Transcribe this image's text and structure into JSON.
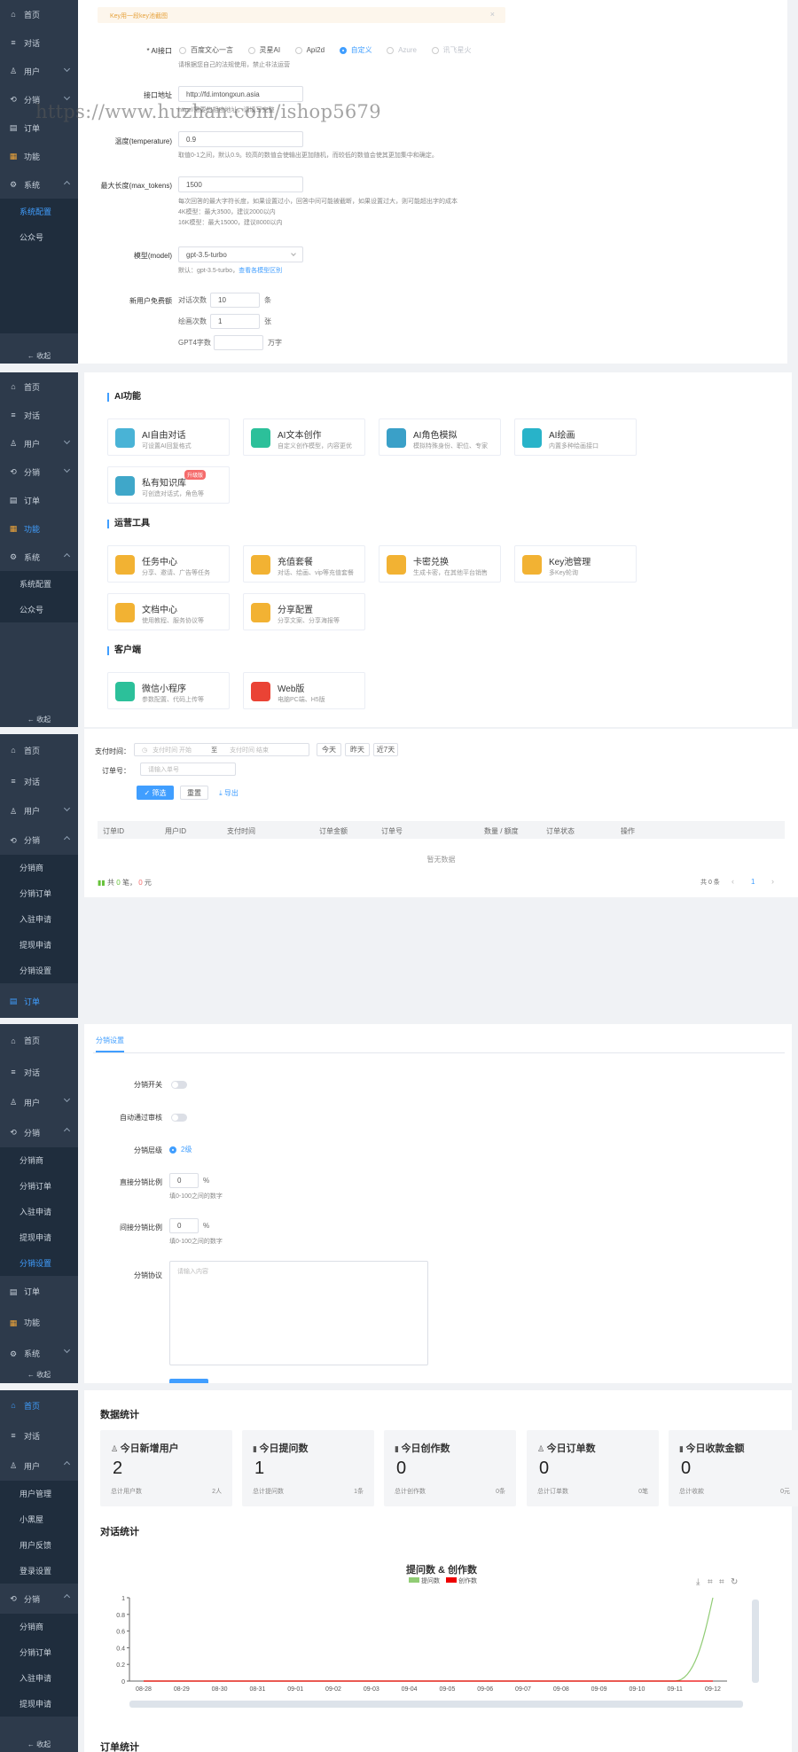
{
  "sidebar1": {
    "items": [
      {
        "label": "首页"
      },
      {
        "label": "对话"
      },
      {
        "label": "用户"
      },
      {
        "label": "分销"
      },
      {
        "label": "订单"
      },
      {
        "label": "功能"
      },
      {
        "label": "系统"
      }
    ],
    "sub": [
      {
        "label": "系统配置"
      },
      {
        "label": "公众号"
      }
    ],
    "collapse": "← 收起"
  },
  "sidebar2": {
    "items": [
      {
        "label": "首页"
      },
      {
        "label": "对话"
      },
      {
        "label": "用户"
      },
      {
        "label": "分销"
      },
      {
        "label": "订单"
      },
      {
        "label": "功能"
      },
      {
        "label": "系统"
      }
    ],
    "sub": [
      {
        "label": "系统配置"
      },
      {
        "label": "公众号"
      }
    ],
    "collapse": "← 收起"
  },
  "sidebar3": {
    "items": [
      {
        "label": "首页"
      },
      {
        "label": "对话"
      },
      {
        "label": "用户"
      },
      {
        "label": "分销"
      }
    ],
    "sub": [
      {
        "label": "分销商"
      },
      {
        "label": "分销订单"
      },
      {
        "label": "入驻申请"
      },
      {
        "label": "提现申请"
      },
      {
        "label": "分销设置"
      }
    ],
    "after": [
      {
        "label": "订单"
      }
    ]
  },
  "sidebar4": {
    "items": [
      {
        "label": "首页"
      },
      {
        "label": "对话"
      },
      {
        "label": "用户"
      },
      {
        "label": "分销"
      }
    ],
    "sub": [
      {
        "label": "分销商"
      },
      {
        "label": "分销订单"
      },
      {
        "label": "入驻申请"
      },
      {
        "label": "提现申请"
      },
      {
        "label": "分销设置"
      }
    ],
    "after": [
      {
        "label": "订单"
      },
      {
        "label": "功能"
      },
      {
        "label": "系统"
      }
    ],
    "collapse": "← 收起"
  },
  "sidebar5": {
    "items": [
      {
        "label": "首页"
      },
      {
        "label": "对话"
      },
      {
        "label": "用户"
      }
    ],
    "sub": [
      {
        "label": "用户管理"
      },
      {
        "label": "小黑屋"
      },
      {
        "label": "用户反馈"
      },
      {
        "label": "登录设置"
      }
    ],
    "after": [
      {
        "label": "分销"
      }
    ],
    "sub2": [
      {
        "label": "分销商"
      },
      {
        "label": "分销订单"
      },
      {
        "label": "入驻申请"
      },
      {
        "label": "提现申请"
      }
    ],
    "collapse": "← 收起"
  },
  "watermark": "https://www.huzhan.com/ishop5679",
  "ai_config": {
    "alert": "Key用一段key池截图",
    "alert_close": "×",
    "interface_label": "* AI接口",
    "interface_options": [
      {
        "label": "百度文心一言",
        "state": "off"
      },
      {
        "label": "灵星AI",
        "state": "off"
      },
      {
        "label": "Api2d",
        "state": "off"
      },
      {
        "label": "自定义",
        "state": "on"
      },
      {
        "label": "Azure",
        "state": "disabled"
      },
      {
        "label": "讯飞星火",
        "state": "disabled"
      }
    ],
    "interface_hint": "请根据您自己的法规使用，禁止非法运营",
    "url_label": "接口地址",
    "url_value": "http://fd.imtongxun.asia",
    "url_hint": "http://需要的相应地址，请填写完整",
    "temp_label": "温度(temperature)",
    "temp_value": "0.9",
    "temp_hint": "取值0-1之间，默认0.9。较高的数值会使输出更加随机，而较低的数值会使其更加集中和确定。",
    "max_label": "最大长度(max_tokens)",
    "max_value": "1500",
    "max_hint1": "每次回答的最大字符长度，如果设置过小，回答中间可能被截断，如果设置过大，则可能超出字的成本",
    "max_hint2": "4K模型：最大3500，建议2000以内",
    "max_hint3": "16K模型：最大15000，建议8000以内",
    "model_label": "模型(model)",
    "model_value": "gpt-3.5-turbo",
    "model_hint": "默认：gpt-3.5-turbo，",
    "model_link": "查看各模型区别",
    "free_label": "新用户免费额",
    "free_rows": [
      {
        "label": "对话次数",
        "value": "10",
        "unit": "条"
      },
      {
        "label": "绘画次数",
        "value": "1",
        "unit": "张"
      },
      {
        "label": "GPT4字数",
        "value": "",
        "unit": "万字"
      }
    ]
  },
  "features": {
    "section1": "AI功能",
    "ai_tiles": [
      {
        "title": "AI自由对话",
        "desc": "可设置AI回复格式",
        "color": "#49b3d6"
      },
      {
        "title": "AI文本创作",
        "desc": "自定义创作模型，内容更优",
        "color": "#2cc09a"
      },
      {
        "title": "AI角色模拟",
        "desc": "模拟特殊身份、职位、专家",
        "color": "#3aa0c8"
      },
      {
        "title": "AI绘画",
        "desc": "内置多种绘画接口",
        "color": "#28b3c9"
      },
      {
        "title": "私有知识库",
        "desc": "可创造对话式，角色等",
        "color": "#3fa7c9"
      }
    ],
    "new_badge": "升级版",
    "section2": "运营工具",
    "op_tiles": [
      {
        "title": "任务中心",
        "desc": "分享、邀请、广告等任务",
        "color": "#f2b233"
      },
      {
        "title": "充值套餐",
        "desc": "对话、绘画、vip等充值套餐",
        "color": "#f2b233"
      },
      {
        "title": "卡密兑换",
        "desc": "生成卡密，在其他平台销售",
        "color": "#f2b233"
      },
      {
        "title": "Key池管理",
        "desc": "多Key轮询",
        "color": "#f2b233"
      },
      {
        "title": "文档中心",
        "desc": "使用教程、服务协议等",
        "color": "#f2b233"
      },
      {
        "title": "分享配置",
        "desc": "分享文案、分享海报等",
        "color": "#f2b233"
      }
    ],
    "section3": "客户端",
    "client_tiles": [
      {
        "title": "微信小程序",
        "desc": "参数配置、代码上传等",
        "color": "#2cc09a"
      },
      {
        "title": "Web版",
        "desc": "电脑PC端、H5版",
        "color": "#ea4335"
      }
    ]
  },
  "orders": {
    "pay_time_label": "支付时间：",
    "start_placeholder": "支付时间 开始",
    "to": "至",
    "end_placeholder": "支付时间 结束",
    "quick": [
      "今天",
      "昨天",
      "近7天"
    ],
    "order_no_label": "订单号：",
    "order_no_placeholder": "请输入单号",
    "search": "✓ 筛选",
    "reset": "重置",
    "export": "⤓ 导出",
    "columns": [
      "订单ID",
      "用户ID",
      "支付时间",
      "订单金额",
      "订单号",
      "数量 / 额度",
      "订单状态",
      "操作"
    ],
    "empty": "暂无数据",
    "summary_prefix": "共",
    "summary_count": "0",
    "summary_mid": "笔，",
    "summary_amount": "0",
    "summary_suffix": "元",
    "total": "共 0 条",
    "page": "1"
  },
  "dist_settings": {
    "tab": "分销设置",
    "switch_label": "分销开关",
    "auto_label": "自动通过审核",
    "level_label": "分销层级",
    "level_value": "2级",
    "direct_label": "直接分销比例",
    "direct_value": "0",
    "direct_unit": "%",
    "direct_hint": "填0-100之间的数字",
    "indirect_label": "间接分销比例",
    "indirect_value": "0",
    "indirect_unit": "%",
    "indirect_hint": "填0-100之间的数字",
    "agreement_label": "分销协议",
    "agreement_placeholder": "请输入内容"
  },
  "dashboard": {
    "title": "数据统计",
    "stats": [
      {
        "head": "今日新增用户",
        "value": "2",
        "left": "总计用户数",
        "right": "2人",
        "icon": "user-icon"
      },
      {
        "head": "今日提问数",
        "value": "1",
        "left": "总计提问数",
        "right": "1条",
        "icon": "bar-icon"
      },
      {
        "head": "今日创作数",
        "value": "0",
        "left": "总计创作数",
        "right": "0条",
        "icon": "bar-icon"
      },
      {
        "head": "今日订单数",
        "value": "0",
        "left": "总计订单数",
        "right": "0笔",
        "icon": "user-icon"
      },
      {
        "head": "今日收款金额",
        "value": "0",
        "left": "总计收款",
        "right": "0元",
        "icon": "bar-icon"
      }
    ],
    "chat_title": "对话统计",
    "order_title": "订单统计"
  },
  "chart_data": {
    "type": "line",
    "title": "提问数 & 创作数",
    "x": [
      "08-28",
      "08-29",
      "08-30",
      "08-31",
      "09-01",
      "09-02",
      "09-03",
      "09-04",
      "09-05",
      "09-06",
      "09-07",
      "09-08",
      "09-09",
      "09-10",
      "09-11",
      "09-12"
    ],
    "yticks": [
      "0",
      "0.2",
      "0.4",
      "0.6",
      "0.8",
      "1"
    ],
    "ylim": [
      0,
      1
    ],
    "series": [
      {
        "name": "提问数",
        "color": "#91cc75",
        "values": [
          0,
          0,
          0,
          0,
          0,
          0,
          0,
          0,
          0,
          0,
          0,
          0,
          0,
          0,
          0,
          1
        ]
      },
      {
        "name": "创作数",
        "color": "#ee0000",
        "values": [
          0,
          0,
          0,
          0,
          0,
          0,
          0,
          0,
          0,
          0,
          0,
          0,
          0,
          0,
          0,
          0
        ]
      }
    ],
    "legend": "top-center",
    "grid": false
  }
}
